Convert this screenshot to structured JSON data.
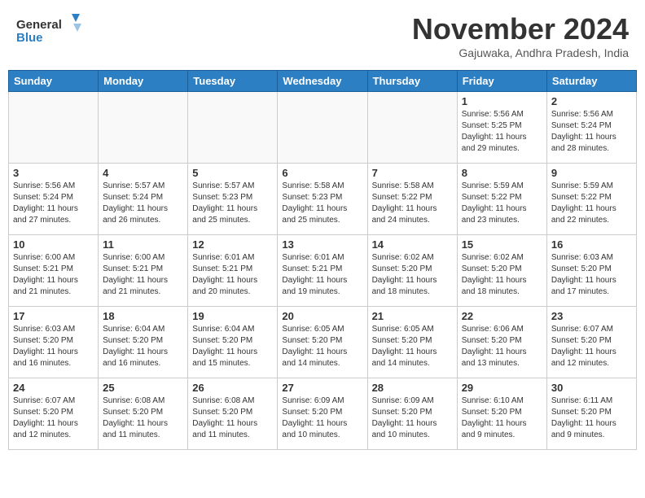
{
  "logo": {
    "line1": "General",
    "line2": "Blue"
  },
  "header": {
    "month": "November 2024",
    "location": "Gajuwaka, Andhra Pradesh, India"
  },
  "weekdays": [
    "Sunday",
    "Monday",
    "Tuesday",
    "Wednesday",
    "Thursday",
    "Friday",
    "Saturday"
  ],
  "weeks": [
    [
      {
        "day": "",
        "info": ""
      },
      {
        "day": "",
        "info": ""
      },
      {
        "day": "",
        "info": ""
      },
      {
        "day": "",
        "info": ""
      },
      {
        "day": "",
        "info": ""
      },
      {
        "day": "1",
        "info": "Sunrise: 5:56 AM\nSunset: 5:25 PM\nDaylight: 11 hours\nand 29 minutes."
      },
      {
        "day": "2",
        "info": "Sunrise: 5:56 AM\nSunset: 5:24 PM\nDaylight: 11 hours\nand 28 minutes."
      }
    ],
    [
      {
        "day": "3",
        "info": "Sunrise: 5:56 AM\nSunset: 5:24 PM\nDaylight: 11 hours\nand 27 minutes."
      },
      {
        "day": "4",
        "info": "Sunrise: 5:57 AM\nSunset: 5:24 PM\nDaylight: 11 hours\nand 26 minutes."
      },
      {
        "day": "5",
        "info": "Sunrise: 5:57 AM\nSunset: 5:23 PM\nDaylight: 11 hours\nand 25 minutes."
      },
      {
        "day": "6",
        "info": "Sunrise: 5:58 AM\nSunset: 5:23 PM\nDaylight: 11 hours\nand 25 minutes."
      },
      {
        "day": "7",
        "info": "Sunrise: 5:58 AM\nSunset: 5:22 PM\nDaylight: 11 hours\nand 24 minutes."
      },
      {
        "day": "8",
        "info": "Sunrise: 5:59 AM\nSunset: 5:22 PM\nDaylight: 11 hours\nand 23 minutes."
      },
      {
        "day": "9",
        "info": "Sunrise: 5:59 AM\nSunset: 5:22 PM\nDaylight: 11 hours\nand 22 minutes."
      }
    ],
    [
      {
        "day": "10",
        "info": "Sunrise: 6:00 AM\nSunset: 5:21 PM\nDaylight: 11 hours\nand 21 minutes."
      },
      {
        "day": "11",
        "info": "Sunrise: 6:00 AM\nSunset: 5:21 PM\nDaylight: 11 hours\nand 21 minutes."
      },
      {
        "day": "12",
        "info": "Sunrise: 6:01 AM\nSunset: 5:21 PM\nDaylight: 11 hours\nand 20 minutes."
      },
      {
        "day": "13",
        "info": "Sunrise: 6:01 AM\nSunset: 5:21 PM\nDaylight: 11 hours\nand 19 minutes."
      },
      {
        "day": "14",
        "info": "Sunrise: 6:02 AM\nSunset: 5:20 PM\nDaylight: 11 hours\nand 18 minutes."
      },
      {
        "day": "15",
        "info": "Sunrise: 6:02 AM\nSunset: 5:20 PM\nDaylight: 11 hours\nand 18 minutes."
      },
      {
        "day": "16",
        "info": "Sunrise: 6:03 AM\nSunset: 5:20 PM\nDaylight: 11 hours\nand 17 minutes."
      }
    ],
    [
      {
        "day": "17",
        "info": "Sunrise: 6:03 AM\nSunset: 5:20 PM\nDaylight: 11 hours\nand 16 minutes."
      },
      {
        "day": "18",
        "info": "Sunrise: 6:04 AM\nSunset: 5:20 PM\nDaylight: 11 hours\nand 16 minutes."
      },
      {
        "day": "19",
        "info": "Sunrise: 6:04 AM\nSunset: 5:20 PM\nDaylight: 11 hours\nand 15 minutes."
      },
      {
        "day": "20",
        "info": "Sunrise: 6:05 AM\nSunset: 5:20 PM\nDaylight: 11 hours\nand 14 minutes."
      },
      {
        "day": "21",
        "info": "Sunrise: 6:05 AM\nSunset: 5:20 PM\nDaylight: 11 hours\nand 14 minutes."
      },
      {
        "day": "22",
        "info": "Sunrise: 6:06 AM\nSunset: 5:20 PM\nDaylight: 11 hours\nand 13 minutes."
      },
      {
        "day": "23",
        "info": "Sunrise: 6:07 AM\nSunset: 5:20 PM\nDaylight: 11 hours\nand 12 minutes."
      }
    ],
    [
      {
        "day": "24",
        "info": "Sunrise: 6:07 AM\nSunset: 5:20 PM\nDaylight: 11 hours\nand 12 minutes."
      },
      {
        "day": "25",
        "info": "Sunrise: 6:08 AM\nSunset: 5:20 PM\nDaylight: 11 hours\nand 11 minutes."
      },
      {
        "day": "26",
        "info": "Sunrise: 6:08 AM\nSunset: 5:20 PM\nDaylight: 11 hours\nand 11 minutes."
      },
      {
        "day": "27",
        "info": "Sunrise: 6:09 AM\nSunset: 5:20 PM\nDaylight: 11 hours\nand 10 minutes."
      },
      {
        "day": "28",
        "info": "Sunrise: 6:09 AM\nSunset: 5:20 PM\nDaylight: 11 hours\nand 10 minutes."
      },
      {
        "day": "29",
        "info": "Sunrise: 6:10 AM\nSunset: 5:20 PM\nDaylight: 11 hours\nand 9 minutes."
      },
      {
        "day": "30",
        "info": "Sunrise: 6:11 AM\nSunset: 5:20 PM\nDaylight: 11 hours\nand 9 minutes."
      }
    ]
  ]
}
